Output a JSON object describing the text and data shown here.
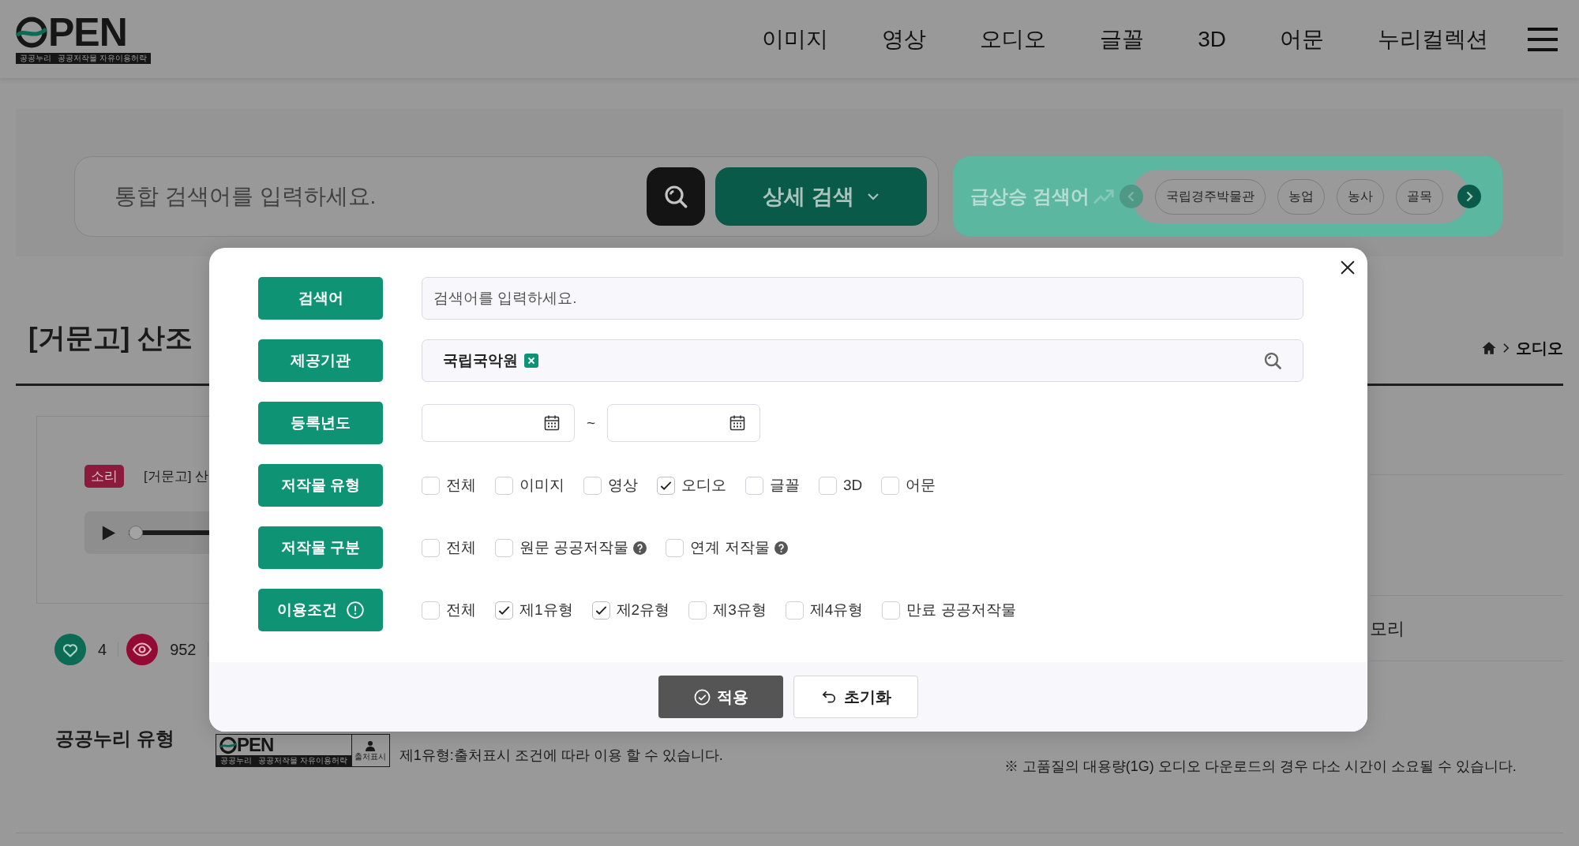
{
  "header": {
    "logo": {
      "wordmark": "PEN",
      "tagline": [
        "공공누리",
        "공공저작물 자유이용허락"
      ]
    },
    "nav": [
      "이미지",
      "영상",
      "오디오",
      "글꼴",
      "3D",
      "어문",
      "누리컬렉션"
    ]
  },
  "search_bar": {
    "placeholder": "통합 검색어를 입력하세요.",
    "advanced_button": "상세 검색"
  },
  "trending": {
    "title": "급상승 검색어",
    "arrows": [
      {
        "kind": "prev",
        "disabled": true
      },
      {
        "kind": "next",
        "disabled": false
      }
    ],
    "keywords": [
      "국립경주박물관",
      "농업",
      "농사",
      "골목"
    ]
  },
  "detail": {
    "title": "[거문고] 산조",
    "breadcrumb": "오디오",
    "card": {
      "badge": "소리",
      "title": "[거문고] 산",
      "player": {
        "level": 0
      }
    },
    "stats": [
      {
        "kind": "likes",
        "count": "4"
      },
      {
        "kind": "views",
        "count": "952"
      }
    ],
    "side_text": "모리"
  },
  "license": {
    "heading": "공공누리 유형",
    "logo": {
      "wordmark": "PEN",
      "badge": "출처표시",
      "tagline": [
        "공공누리",
        "공공저작물 자유이용허락"
      ]
    },
    "description": "제1유형:출처표시 조건에 따라 이용 할 수 있습니다.",
    "notice": "※ 고품질의 대용량(1G) 오디오 다운로드의 경우 다소 시간이 소요될 수 있습니다."
  },
  "modal": {
    "rows": [
      {
        "kind": "text",
        "label": "검색어",
        "placeholder": "검색어를 입력하세요."
      },
      {
        "kind": "tags",
        "label": "제공기관",
        "tags": [
          "국립국악원"
        ]
      },
      {
        "kind": "date_range",
        "label": "등록년도",
        "separator": "~"
      },
      {
        "kind": "checkboxes",
        "label": "저작물 유형",
        "options": [
          {
            "label": "전체",
            "checked": false
          },
          {
            "label": "이미지",
            "checked": false
          },
          {
            "label": "영상",
            "checked": false
          },
          {
            "label": "오디오",
            "checked": true
          },
          {
            "label": "글꼴",
            "checked": false
          },
          {
            "label": "3D",
            "checked": false
          },
          {
            "label": "어문",
            "checked": false
          }
        ]
      },
      {
        "kind": "checkboxes",
        "label": "저작물 구분",
        "options": [
          {
            "label": "전체",
            "checked": false,
            "help": false
          },
          {
            "label": "원문 공공저작물",
            "checked": false,
            "help": true
          },
          {
            "label": "연계 저작물",
            "checked": false,
            "help": true
          }
        ]
      },
      {
        "kind": "checkboxes",
        "label": "이용조건",
        "info": true,
        "options": [
          {
            "label": "전체",
            "checked": false
          },
          {
            "label": "제1유형",
            "checked": true
          },
          {
            "label": "제2유형",
            "checked": true
          },
          {
            "label": "제3유형",
            "checked": false
          },
          {
            "label": "제4유형",
            "checked": false
          },
          {
            "label": "만료 공공저작물",
            "checked": false
          }
        ]
      }
    ],
    "buttons": [
      {
        "kind": "apply",
        "label": "적용"
      },
      {
        "kind": "reset",
        "label": "초기화"
      }
    ]
  }
}
